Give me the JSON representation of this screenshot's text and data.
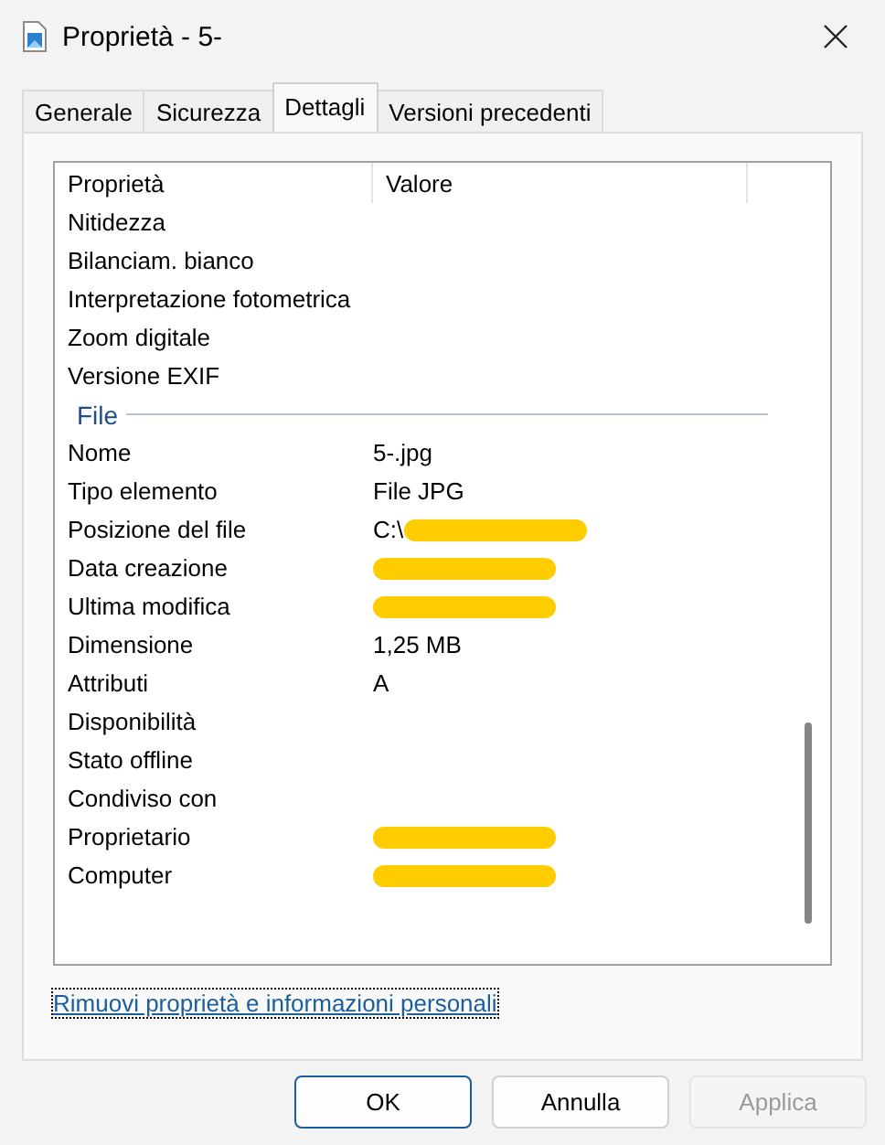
{
  "window": {
    "title": "Proprietà - 5-"
  },
  "tabs": [
    {
      "label": "Generale",
      "selected": false
    },
    {
      "label": "Sicurezza",
      "selected": false
    },
    {
      "label": "Dettagli",
      "selected": true
    },
    {
      "label": "Versioni precedenti",
      "selected": false
    }
  ],
  "table": {
    "columns": [
      "Proprietà",
      "Valore"
    ],
    "rows": [
      {
        "kind": "row",
        "name": "Nitidezza"
      },
      {
        "kind": "row",
        "name": "Bilanciam. bianco"
      },
      {
        "kind": "row",
        "name": "Interpretazione fotometrica"
      },
      {
        "kind": "row",
        "name": "Zoom digitale"
      },
      {
        "kind": "row",
        "name": "Versione EXIF"
      },
      {
        "kind": "section",
        "name": "File"
      },
      {
        "kind": "row",
        "name": "Nome",
        "value": "5-.jpg"
      },
      {
        "kind": "row",
        "name": "Tipo elemento",
        "value": "File JPG"
      },
      {
        "kind": "row",
        "name": "Posizione del file",
        "value": "C:\\",
        "redacted": true
      },
      {
        "kind": "row",
        "name": "Data creazione",
        "redacted": true
      },
      {
        "kind": "row",
        "name": "Ultima modifica",
        "redacted": true
      },
      {
        "kind": "row",
        "name": "Dimensione",
        "value": "1,25 MB"
      },
      {
        "kind": "row",
        "name": "Attributi",
        "value": "A"
      },
      {
        "kind": "row",
        "name": "Disponibilità"
      },
      {
        "kind": "row",
        "name": "Stato offline"
      },
      {
        "kind": "row",
        "name": "Condiviso con"
      },
      {
        "kind": "row",
        "name": "Proprietario",
        "redacted": true
      },
      {
        "kind": "row",
        "name": "Computer",
        "redacted": true
      }
    ]
  },
  "link": "Rimuovi proprietà e informazioni personali",
  "buttons": [
    {
      "label": "OK",
      "disabled": false,
      "default": true
    },
    {
      "label": "Annulla",
      "disabled": false,
      "default": false
    },
    {
      "label": "Applica",
      "disabled": true,
      "default": false
    }
  ]
}
